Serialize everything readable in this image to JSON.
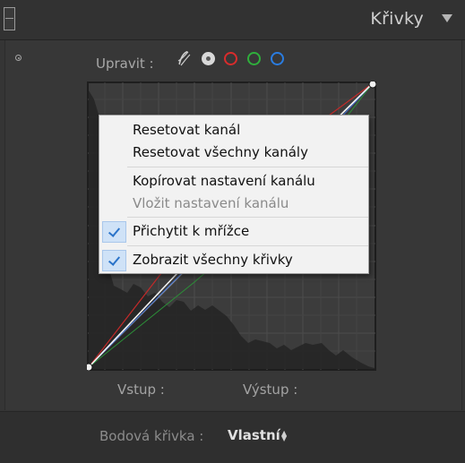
{
  "panel": {
    "title": "Křivky"
  },
  "toolbar": {
    "upravit_label": "Upravit :",
    "channels": [
      "parametric-curve",
      "point-curve",
      "red",
      "green",
      "blue"
    ]
  },
  "readout": {
    "input_label": "Vstup :",
    "output_label": "Výstup :"
  },
  "footer": {
    "point_curve_label": "Bodová křivka :",
    "point_curve_value": "Vlastní"
  },
  "context_menu": {
    "items": [
      {
        "label": "Resetovat kanál",
        "enabled": true
      },
      {
        "label": "Resetovat všechny kanály",
        "enabled": true
      },
      {
        "label": "Kopírovat nastavení kanálu",
        "enabled": true
      },
      {
        "label": "Vložit nastavení kanálu",
        "enabled": false
      },
      {
        "label": "Přichytit k mřížce",
        "enabled": true,
        "checked": true
      },
      {
        "label": "Zobrazit všechny křivky",
        "enabled": true,
        "checked": true
      }
    ]
  },
  "colors": {
    "red_channel": "#d82c2c",
    "green_channel": "#2fae3c",
    "blue_channel": "#2a7ce0",
    "check_highlight": "#cfe2f7"
  }
}
